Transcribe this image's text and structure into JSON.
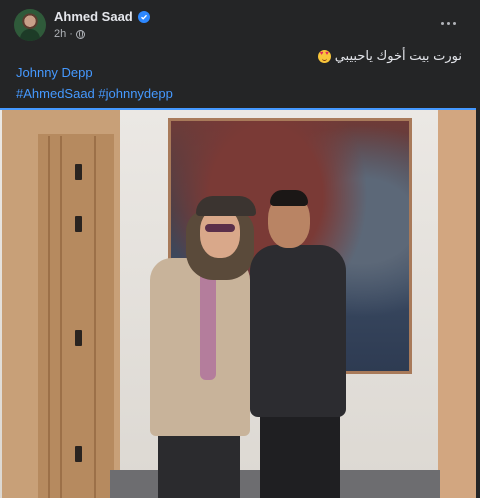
{
  "post": {
    "author": "Ahmed Saad",
    "time": "2h",
    "caption_text": "نورت بيت أخوك ياحبيبي",
    "caption_emoji": "smiling-face-with-heart-eyes-icon",
    "mention": "Johnny Depp",
    "hashtags": "#AhmedSaad #johnnydepp"
  },
  "colors": {
    "background": "#242526",
    "link": "#4599ff",
    "verified": "#2d88ff"
  }
}
